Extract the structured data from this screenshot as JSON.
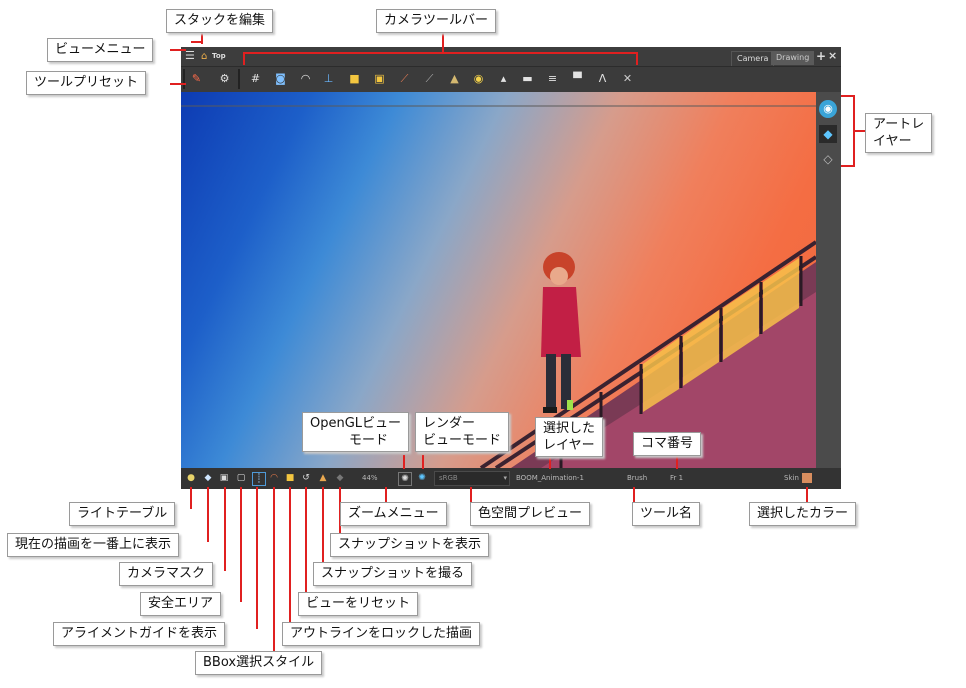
{
  "window": {
    "breadcrumb": "Top",
    "tabs": [
      "Camera",
      "Drawing"
    ],
    "add_icon": "plus-icon",
    "close_icon": "close-icon"
  },
  "toolbar_icons": [
    "grid-icon",
    "fit-icon",
    "onion-icon",
    "flip-icon",
    "lock-icon",
    "lock-layer-icon",
    "ruler-icon",
    "line-icon",
    "brush-icon",
    "bulb-icon",
    "disc-icon",
    "flat-disc-icon",
    "stack-icon",
    "hat-icon",
    "deform-icon",
    "bone-icon"
  ],
  "status": {
    "zoom": "44%",
    "color_space": "sRGB",
    "layer": "BOOM_Animation-1",
    "tool": "Brush",
    "frame": "Fr 1",
    "color_name": "Skin",
    "color_swatch": "#d88e5f"
  },
  "labels": {
    "edit_stack": "スタックを編集",
    "camera_toolbar": "カメラツールバー",
    "view_menu": "ビューメニュー",
    "tool_presets": "ツールプリセット",
    "art_layer": "アートレ\nイヤー",
    "opengl_mode": "OpenGLビュー\n　　　モード",
    "render_mode": "レンダー\nビューモード",
    "selected_layer": "選択した\nレイヤー",
    "frame_number": "コマ番号",
    "light_table": "ライトテーブル",
    "show_current_top": "現在の描画を一番上に表示",
    "camera_mask": "カメラマスク",
    "safe_area": "安全エリア",
    "alignment_guide": "アライメントガイドを表示",
    "bbox_style": "BBox選択スタイル",
    "outline_locked": "アウトラインをロックした描画",
    "reset_view": "ビューをリセット",
    "take_snapshot": "スナップショットを撮る",
    "show_snapshot": "スナップショットを表示",
    "zoom_menu": "ズームメニュー",
    "color_space_preview": "色空間プレビュー",
    "tool_name": "ツール名",
    "selected_color": "選択したカラー"
  },
  "colors": {
    "callout_line": "#e02020",
    "app_bg": "#3a3a3a"
  }
}
